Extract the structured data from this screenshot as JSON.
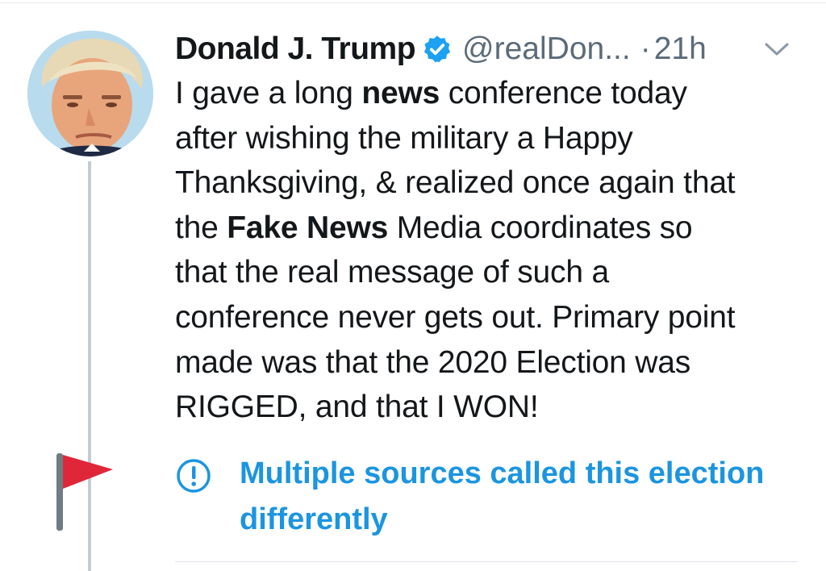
{
  "tweet": {
    "author_name": "Donald J. Trump",
    "handle": "@realDon...",
    "separator": "·",
    "time": "21h",
    "avatar_icon": "profile-photo",
    "verified_icon": "verified-badge-icon",
    "menu_icon": "chevron-down-icon",
    "body_lines": [
      [
        {
          "text": "I gave a long ",
          "bold": false
        },
        {
          "text": "news",
          "bold": true
        },
        {
          "text": " conference today",
          "bold": false
        }
      ],
      [
        {
          "text": "after wishing the military a Happy",
          "bold": false
        }
      ],
      [
        {
          "text": "Thanksgiving, & realized once again that",
          "bold": false
        }
      ],
      [
        {
          "text": "the ",
          "bold": false
        },
        {
          "text": "Fake News",
          "bold": true
        },
        {
          "text": " Media coordinates so",
          "bold": false
        }
      ],
      [
        {
          "text": "that the real message of such a",
          "bold": false
        }
      ],
      [
        {
          "text": "conference never gets out. Primary point",
          "bold": false
        }
      ],
      [
        {
          "text": "made was that the 2020 Election was",
          "bold": false
        }
      ],
      [
        {
          "text": "RIGGED, and that I WON!",
          "bold": false
        }
      ]
    ],
    "notice": {
      "icon": "info-icon",
      "lines": [
        "Multiple sources called this election",
        "differently"
      ]
    }
  },
  "annotation": {
    "flag_icon": "red-flag-icon"
  },
  "colors": {
    "link_blue": "#1b95e0",
    "verified_blue": "#1da1f2",
    "text": "#14171a",
    "muted": "#5b6b79",
    "thread_line": "#c4ccd3",
    "flag_red": "#e0273a"
  }
}
